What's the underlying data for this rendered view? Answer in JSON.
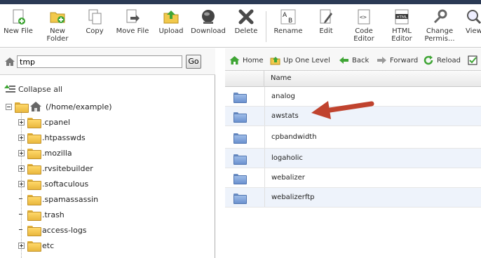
{
  "toolbar": {
    "buttons": [
      {
        "label": "New File",
        "icon": "new-file-icon"
      },
      {
        "label": "New\nFolder",
        "icon": "new-folder-icon"
      },
      {
        "label": "Copy",
        "icon": "copy-icon"
      },
      {
        "label": "Move File",
        "icon": "move-file-icon"
      },
      {
        "label": "Upload",
        "icon": "upload-icon"
      },
      {
        "label": "Download",
        "icon": "download-icon"
      },
      {
        "label": "Delete",
        "icon": "delete-icon"
      },
      {
        "label": "Rename",
        "icon": "rename-icon"
      },
      {
        "label": "Edit",
        "icon": "edit-icon"
      },
      {
        "label": "Code\nEditor",
        "icon": "code-editor-icon"
      },
      {
        "label": "HTML\nEditor",
        "icon": "html-editor-icon"
      },
      {
        "label": "Change\nPermis...",
        "icon": "change-permissions-icon"
      },
      {
        "label": "View",
        "icon": "view-icon"
      }
    ],
    "html_icon_text": "HTML",
    "code_icon_text": "<>"
  },
  "path": {
    "value": "tmp",
    "go_label": "Go"
  },
  "tree": {
    "collapse_label": "Collapse all",
    "root_label": "(/home/example)",
    "items": [
      {
        "label": ".cpanel"
      },
      {
        "label": ".htpasswds"
      },
      {
        "label": ".mozilla"
      },
      {
        "label": ".rvsitebuilder"
      },
      {
        "label": ".softaculous"
      },
      {
        "label": ".spamassassin"
      },
      {
        "label": ".trash"
      },
      {
        "label": "access-logs"
      },
      {
        "label": "etc"
      }
    ]
  },
  "nav": {
    "home": "Home",
    "up": "Up One Level",
    "back": "Back",
    "forward": "Forward",
    "reload": "Reload"
  },
  "table": {
    "name_header": "Name",
    "rows": [
      {
        "name": "analog"
      },
      {
        "name": "awstats"
      },
      {
        "name": "cpbandwidth"
      },
      {
        "name": "logaholic"
      },
      {
        "name": "webalizer"
      },
      {
        "name": "webalizerftp"
      }
    ]
  },
  "colors": {
    "topbar": "#2b3a55",
    "arrow": "#c0432e",
    "folder_blue": "#6b91cf",
    "folder_yellow": "#e9b73e",
    "row_alt": "#eef3fb"
  }
}
